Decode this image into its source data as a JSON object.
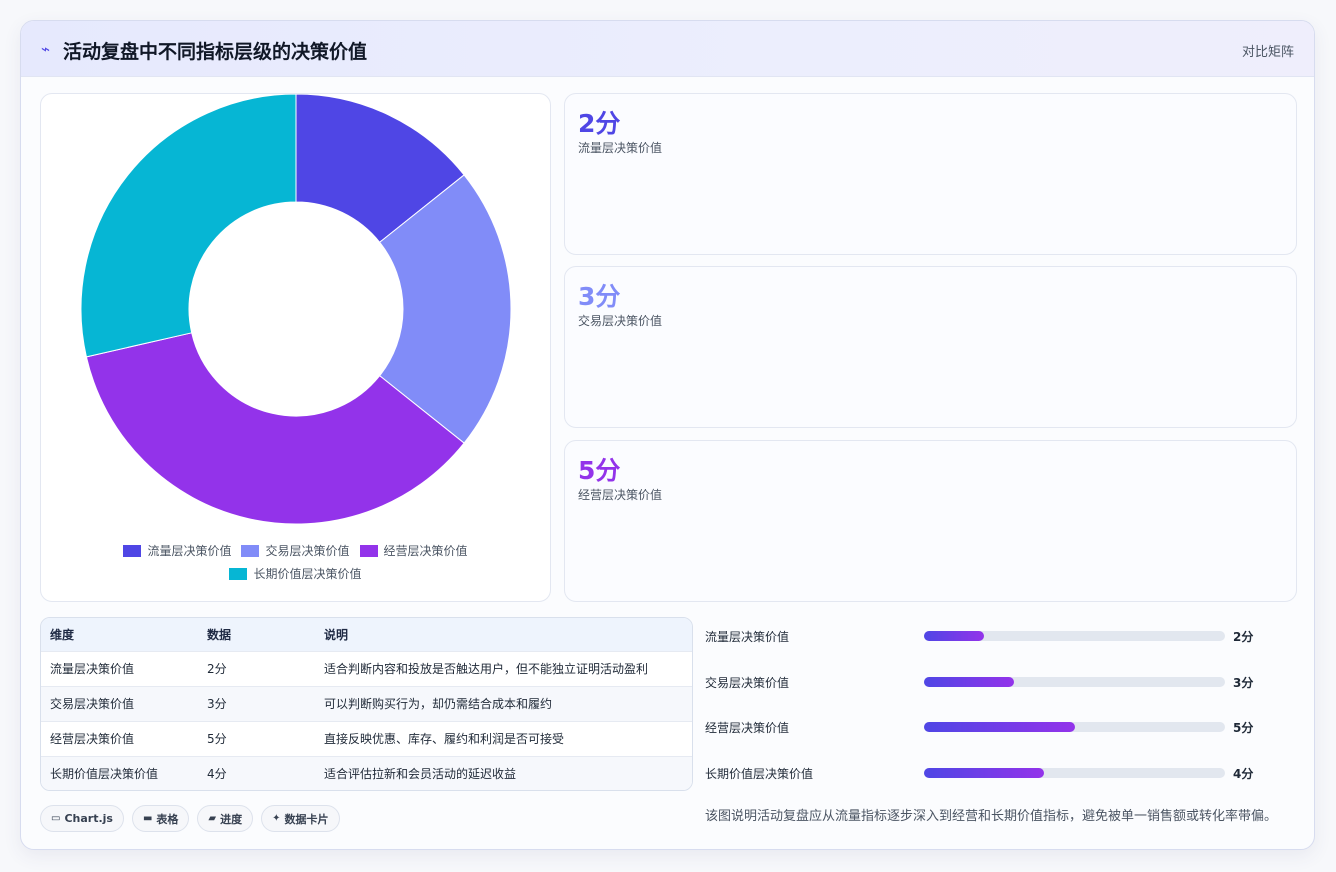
{
  "header": {
    "icon": "lightning-icon",
    "title": "活动复盘中不同指标层级的决策价值",
    "action_label": "对比矩阵"
  },
  "colors": {
    "traffic": "#4f46e5",
    "transaction": "#818cf8",
    "operation": "#9333ea",
    "longterm": "#06b6d4"
  },
  "chart_data": {
    "type": "pie",
    "variant": "doughnut",
    "categories": [
      "流量层决策价值",
      "交易层决策价值",
      "经营层决策价值",
      "长期价值层决策价值"
    ],
    "values": [
      2,
      3,
      5,
      4
    ],
    "colors": [
      "#4f46e5",
      "#818cf8",
      "#9333ea",
      "#06b6d4"
    ],
    "legend": "bottom"
  },
  "stat_cards": [
    {
      "value": "2分",
      "label": "流量层决策价值",
      "color": "#4f46e5"
    },
    {
      "value": "3分",
      "label": "交易层决策价值",
      "color": "#818cf8"
    },
    {
      "value": "5分",
      "label": "经营层决策价值",
      "color": "#9333ea"
    }
  ],
  "table": {
    "headers": [
      "维度",
      "数据",
      "说明"
    ],
    "rows": [
      {
        "dimension": "流量层决策价值",
        "data": "2分",
        "desc": "适合判断内容和投放是否触达用户，但不能独立证明活动盈利"
      },
      {
        "dimension": "交易层决策价值",
        "data": "3分",
        "desc": "可以判断购买行为，却仍需结合成本和履约"
      },
      {
        "dimension": "经营层决策价值",
        "data": "5分",
        "desc": "直接反映优惠、库存、履约和利润是否可接受"
      },
      {
        "dimension": "长期价值层决策价值",
        "data": "4分",
        "desc": "适合评估拉新和会员活动的延迟收益"
      }
    ]
  },
  "progress": {
    "items": [
      {
        "label": "流量层决策价值",
        "value_text": "2分",
        "fraction": 0.2
      },
      {
        "label": "交易层决策价值",
        "value_text": "3分",
        "fraction": 0.3
      },
      {
        "label": "经营层决策价值",
        "value_text": "5分",
        "fraction": 0.5
      },
      {
        "label": "长期价值层决策价值",
        "value_text": "4分",
        "fraction": 0.4
      }
    ]
  },
  "chips": [
    {
      "icon": "monitor-icon",
      "glyph": "▭",
      "label": "Chart.js"
    },
    {
      "icon": "table-icon",
      "glyph": "▬",
      "label": "表格"
    },
    {
      "icon": "progress-icon",
      "glyph": "▰",
      "label": "进度"
    },
    {
      "icon": "sparkle-icon",
      "glyph": "✦",
      "label": "数据卡片"
    }
  ],
  "footnote": "该图说明活动复盘应从流量指标逐步深入到经营和长期价值指标，避免被单一销售额或转化率带偏。"
}
